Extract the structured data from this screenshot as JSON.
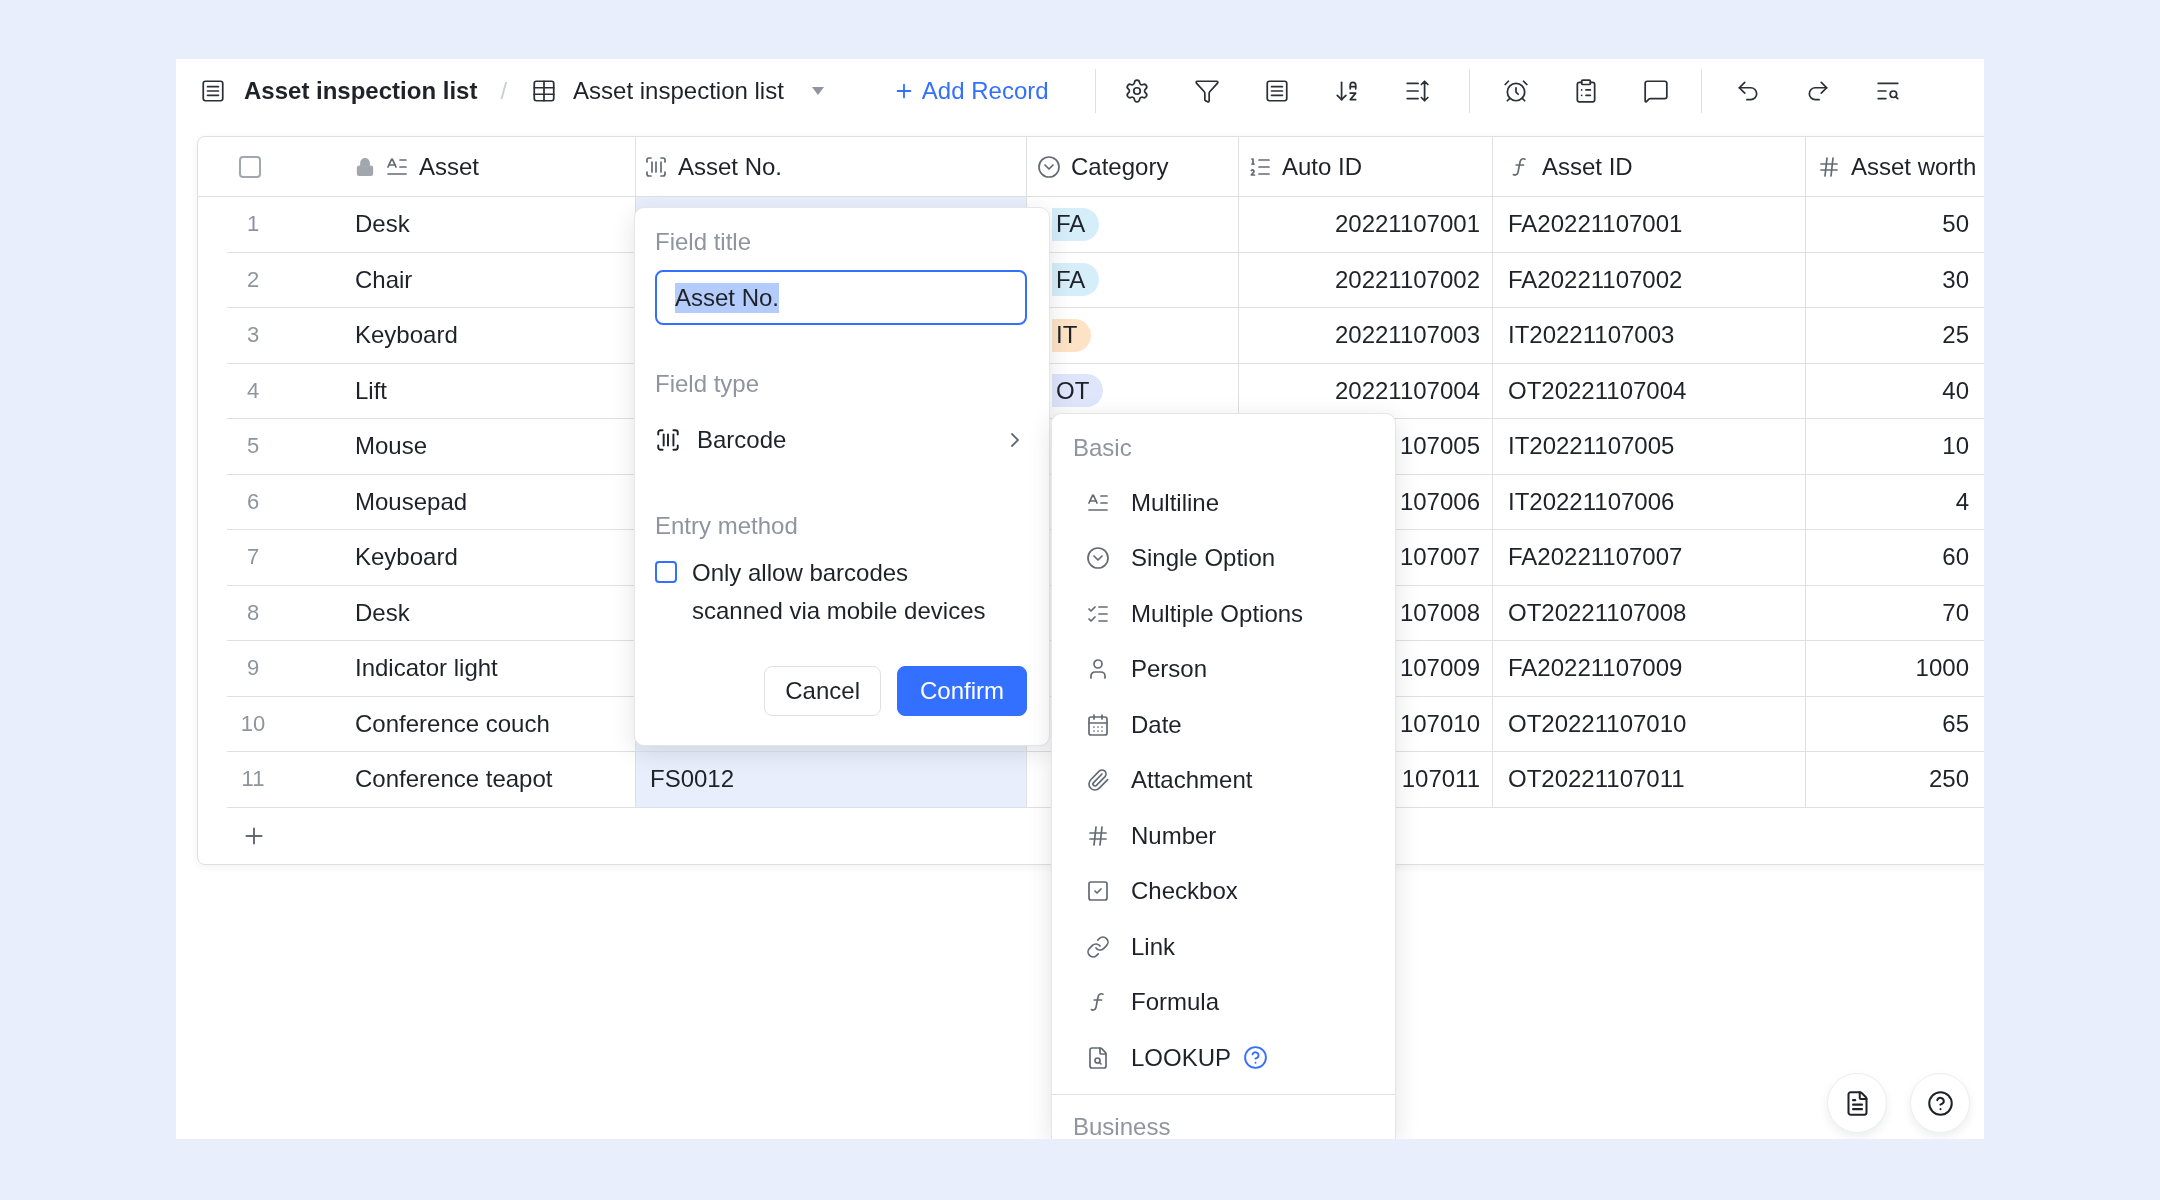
{
  "toolbar": {
    "title": "Asset inspection list",
    "separator": "/",
    "view": "Asset inspection list",
    "add_record": "Add Record"
  },
  "table": {
    "select_all": {
      "checked": false
    },
    "columns": [
      {
        "title": "Asset",
        "locked": true,
        "selected": false
      },
      {
        "title": "Asset No.",
        "locked": false,
        "selected": true
      },
      {
        "title": "Category",
        "locked": false,
        "selected": false
      },
      {
        "title": "Auto ID",
        "locked": false,
        "selected": false
      },
      {
        "title": "Asset ID",
        "locked": false,
        "selected": false
      },
      {
        "title": "Asset worth",
        "locked": false,
        "selected": false
      }
    ],
    "rows": [
      {
        "number": "1",
        "asset": "Desk",
        "category": {
          "label": "FA",
          "color": "#d5eefa"
        },
        "auto_id": "20221107001",
        "asset_id": "FA20221107001",
        "worth": "50"
      },
      {
        "number": "2",
        "asset": "Chair",
        "category": {
          "label": "FA",
          "color": "#d5eefa"
        },
        "auto_id": "20221107002",
        "asset_id": "FA20221107002",
        "worth": "30"
      },
      {
        "number": "3",
        "asset": "Keyboard",
        "category": {
          "label": "IT",
          "color": "#fde2c6"
        },
        "auto_id": "20221107003",
        "asset_id": "IT20221107003",
        "worth": "25"
      },
      {
        "number": "4",
        "asset": "Lift",
        "category": {
          "label": "OT",
          "color": "#dfe5fb"
        },
        "auto_id": "20221107004",
        "asset_id": "OT20221107004",
        "worth": "40"
      },
      {
        "number": "5",
        "asset": "Mouse",
        "auto_id": "107005",
        "asset_id": "IT20221107005",
        "worth": "10"
      },
      {
        "number": "6",
        "asset": "Mousepad",
        "auto_id": "107006",
        "asset_id": "IT20221107006",
        "worth": "4"
      },
      {
        "number": "7",
        "asset": "Keyboard",
        "auto_id": "107007",
        "asset_id": "FA20221107007",
        "worth": "60"
      },
      {
        "number": "8",
        "asset": "Desk",
        "auto_id": "107008",
        "asset_id": "OT20221107008",
        "worth": "70"
      },
      {
        "number": "9",
        "asset": "Indicator light",
        "auto_id": "107009",
        "asset_id": "FA20221107009",
        "worth": "1000"
      },
      {
        "number": "10",
        "asset": "Conference couch",
        "auto_id": "107010",
        "asset_id": "OT20221107010",
        "worth": "65"
      },
      {
        "number": "11",
        "asset": "Conference teapot",
        "asset_no": "FS0012",
        "auto_id": "107011",
        "asset_id": "OT20221107011",
        "worth": "250"
      }
    ]
  },
  "field_settings": {
    "title_label": "Field title",
    "title_value": "Asset No.",
    "title_value_selected": true,
    "type_label": "Field type",
    "type_value": "Barcode",
    "entry_label": "Entry method",
    "mobile_only": {
      "label": "Only allow barcodes scanned via mobile devices",
      "checked": false
    },
    "buttons": [
      {
        "label": "Cancel",
        "kind": "secondary"
      },
      {
        "label": "Confirm",
        "kind": "primary"
      }
    ]
  },
  "type_menu": {
    "sections": [
      {
        "title": "Basic",
        "items": [
          {
            "label": "Multiline",
            "help": false,
            "selected": false
          },
          {
            "label": "Single Option",
            "help": false,
            "selected": false
          },
          {
            "label": "Multiple Options",
            "help": false,
            "selected": false
          },
          {
            "label": "Person",
            "help": false,
            "selected": false
          },
          {
            "label": "Date",
            "help": false,
            "selected": false
          },
          {
            "label": "Attachment",
            "help": false,
            "selected": false
          },
          {
            "label": "Number",
            "help": false,
            "selected": false
          },
          {
            "label": "Checkbox",
            "help": false,
            "selected": false
          },
          {
            "label": "Link",
            "help": false,
            "selected": false
          },
          {
            "label": "Formula",
            "help": false,
            "selected": false
          },
          {
            "label": "LOOKUP",
            "help": true,
            "selected": false
          }
        ]
      },
      {
        "title": "Business"
      }
    ]
  }
}
